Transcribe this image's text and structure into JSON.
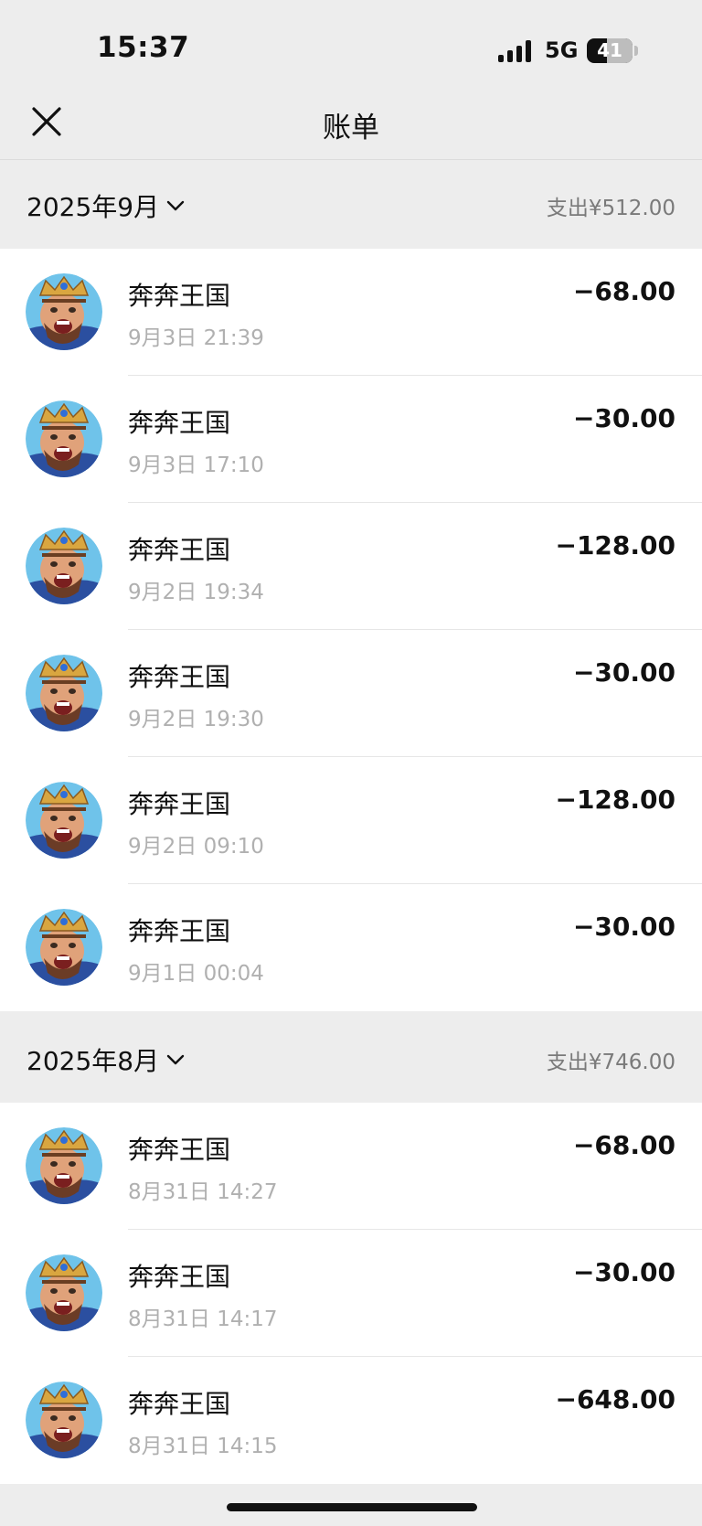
{
  "status_bar": {
    "time": "15:37",
    "network": "5G",
    "battery": "41"
  },
  "nav": {
    "title": "账单"
  },
  "months": [
    {
      "label": "2025年9月",
      "total": "支出¥512.00",
      "transactions": [
        {
          "merchant": "奔奔王国",
          "datetime": "9月3日 21:39",
          "amount": "−68.00"
        },
        {
          "merchant": "奔奔王国",
          "datetime": "9月3日 17:10",
          "amount": "−30.00"
        },
        {
          "merchant": "奔奔王国",
          "datetime": "9月2日 19:34",
          "amount": "−128.00"
        },
        {
          "merchant": "奔奔王国",
          "datetime": "9月2日 19:30",
          "amount": "−30.00"
        },
        {
          "merchant": "奔奔王国",
          "datetime": "9月2日 09:10",
          "amount": "−128.00"
        },
        {
          "merchant": "奔奔王国",
          "datetime": "9月1日 00:04",
          "amount": "−30.00"
        }
      ]
    },
    {
      "label": "2025年8月",
      "total": "支出¥746.00",
      "transactions": [
        {
          "merchant": "奔奔王国",
          "datetime": "8月31日 14:27",
          "amount": "−68.00"
        },
        {
          "merchant": "奔奔王国",
          "datetime": "8月31日 14:17",
          "amount": "−30.00"
        },
        {
          "merchant": "奔奔王国",
          "datetime": "8月31日 14:15",
          "amount": "−648.00"
        }
      ]
    }
  ],
  "icons": {
    "close": "close-icon",
    "dropdown": "chevron-down-icon",
    "avatar": "game-avatar-icon"
  }
}
